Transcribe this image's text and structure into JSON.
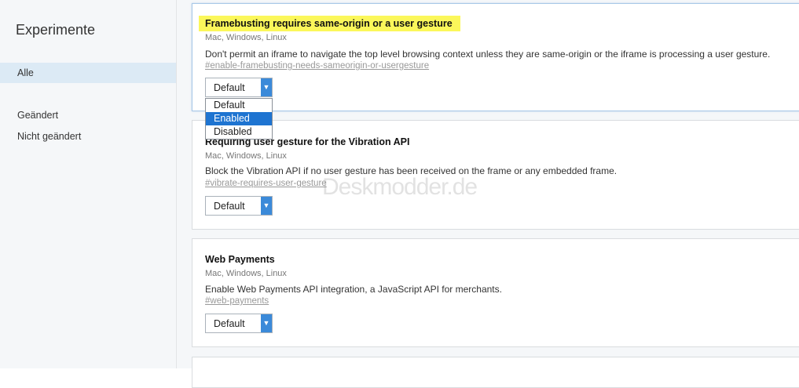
{
  "sidebar": {
    "title": "Experimente",
    "items": [
      {
        "label": "Alle",
        "active": true
      },
      {
        "label": "Geändert",
        "active": false
      },
      {
        "label": "Nicht geändert",
        "active": false
      }
    ]
  },
  "flags": [
    {
      "name": "Framebusting requires same-origin or a user gesture",
      "platforms": "Mac, Windows, Linux",
      "description": "Don't permit an iframe to navigate the top level browsing context unless they are same-origin or the iframe is processing a user gesture.",
      "anchor": "#enable-framebusting-needs-sameorigin-or-usergesture",
      "select_value": "Default"
    },
    {
      "name": "Requiring user gesture for the Vibration API",
      "platforms": "Mac, Windows, Linux",
      "description": "Block the Vibration API if no user gesture has been received on the frame or any embedded frame.",
      "anchor": "#vibrate-requires-user-gesture",
      "select_value": "Default"
    },
    {
      "name": "Web Payments",
      "platforms": "Mac, Windows, Linux",
      "description": "Enable Web Payments API integration, a JavaScript API for merchants.",
      "anchor": "#web-payments",
      "select_value": "Default"
    }
  ],
  "dropdown": {
    "options": [
      "Default",
      "Enabled",
      "Disabled"
    ],
    "highlighted": "Enabled"
  },
  "watermark": "Deskmodder.de",
  "colors": {
    "highlight": "#fbf75a",
    "accent": "#3b8ad9",
    "selected_option": "#1e74d1"
  },
  "icons": {
    "select_arrow": "chevron-down-icon"
  }
}
